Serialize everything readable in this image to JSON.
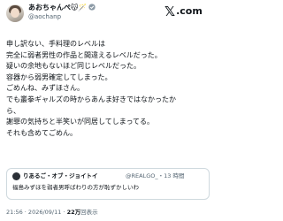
{
  "author": {
    "display_name": "あおちゃんぺ😽🪄",
    "handle": "@aochanp"
  },
  "brand": {
    "x": "𝕏",
    "com": ".com"
  },
  "body_lines": [
    "申し訳ない、手料理のレベルは",
    "完全に弱者男性の作品と間違えるレベルだった。",
    "疑いの余地もないほど同じレベルだった。",
    "容器から弱男確定してしまった。",
    "ごめんね、みずほさん。",
    "でも叢拳ギャルズの時からあんま好きではなかったか",
    "ら、",
    "謝罪の気持ちと半笑いが同居してしまってる。",
    "それも含めてごめん。"
  ],
  "quote": {
    "name": "りあるご・オブ・ジョイトイ",
    "handle": "@REALGO_・13 時間",
    "text": "福島みずほを弱者男呼ばわりの方が恥ずかしいわ"
  },
  "footer": {
    "time": "21:56 · 2026/09/11 · ",
    "views_count": "22万",
    "views_label": "回表示"
  },
  "colors": {
    "verified": "#8c9aa6",
    "muted": "#536471",
    "text": "#0f1419"
  }
}
